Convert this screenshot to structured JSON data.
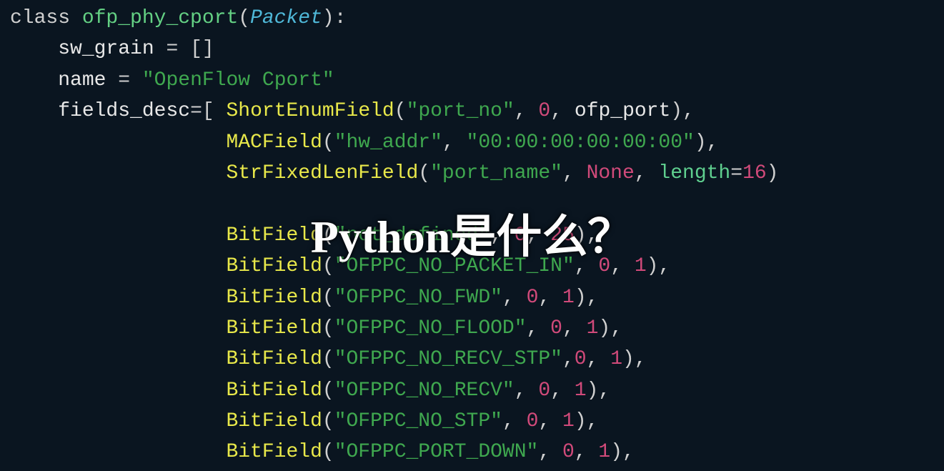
{
  "code": {
    "keyword_class": "class",
    "classname": "ofp_phy_cport",
    "base": "Packet",
    "var_swgrain": "sw_grain",
    "var_name": "name",
    "val_name": "\"OpenFlow Cport\"",
    "var_fields": "fields_desc",
    "funcs": {
      "ShortEnumField": "ShortEnumField",
      "MACField": "MACField",
      "StrFixedLenField": "StrFixedLenField",
      "BitField": "BitField"
    },
    "strings": {
      "port_no": "\"port_no\"",
      "hw_addr": "\"hw_addr\"",
      "mac": "\"00:00:00:00:00:00\"",
      "port_name": "\"port_name\"",
      "not_defined": "\"not_defined\"",
      "ofppc_no_packet_in": "\"OFPPC_NO_PACKET_IN\"",
      "ofppc_no_fwd": "\"OFPPC_NO_FWD\"",
      "ofppc_no_flood": "\"OFPPC_NO_FLOOD\"",
      "ofppc_no_recv_stp": "\"OFPPC_NO_RECV_STP\"",
      "ofppc_no_recv": "\"OFPPC_NO_RECV\"",
      "ofppc_no_stp": "\"OFPPC_NO_STP\"",
      "ofppc_port_down": "\"OFPPC_PORT_DOWN\""
    },
    "nums": {
      "n0": "0",
      "n1": "1",
      "n16": "16",
      "n25": "25"
    },
    "none": "None",
    "ident_ofp_port": "ofp_port",
    "param_length": "length"
  },
  "overlay": "Python是什么？"
}
